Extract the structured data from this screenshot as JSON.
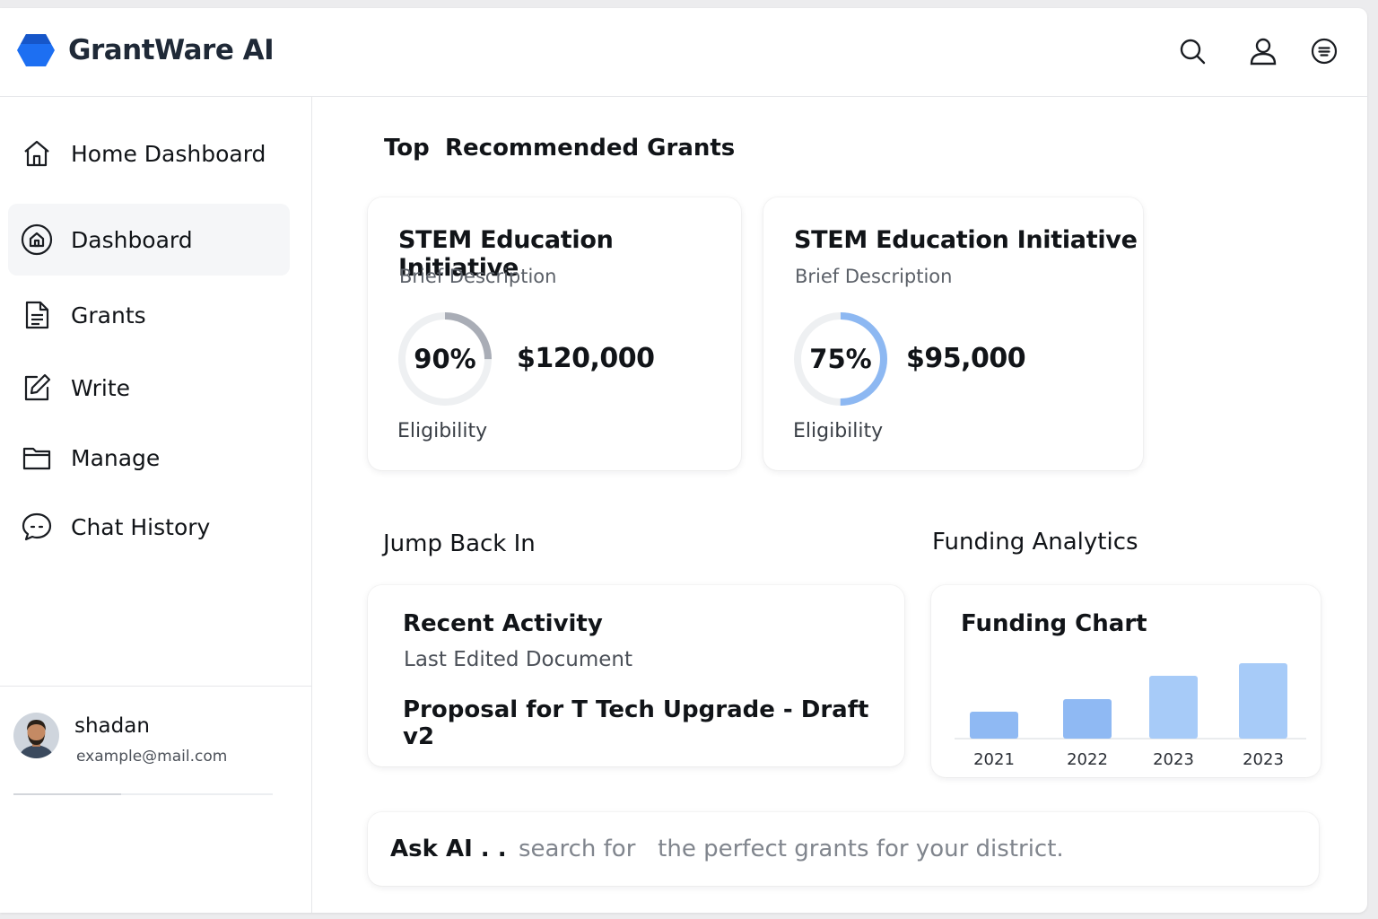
{
  "app": {
    "name": "GrantWare AI",
    "brand_color": "#2563eb"
  },
  "header": {
    "icons": [
      "search-icon",
      "user-icon",
      "menu-icon"
    ]
  },
  "sidebar": {
    "items": [
      {
        "label": "Home Dashboard",
        "icon": "home-icon",
        "active": false
      },
      {
        "label": "Dashboard",
        "icon": "dashboard-icon",
        "active": true
      },
      {
        "label": "Grants",
        "icon": "document-icon",
        "active": false
      },
      {
        "label": "Write",
        "icon": "edit-icon",
        "active": false
      },
      {
        "label": "Manage",
        "icon": "folder-icon",
        "active": false
      },
      {
        "label": "Chat History",
        "icon": "chat-icon",
        "active": false
      }
    ],
    "user": {
      "name": "shadan",
      "email": "example@mail.com"
    }
  },
  "main": {
    "recommended_title_a": "Top",
    "recommended_title_b": "Recommended Grants",
    "grants": [
      {
        "title": "STEM Education Initiative",
        "description": "Brief Description",
        "eligibility_value": "90%",
        "eligibility_fraction": 0.9,
        "amount": "$120,000",
        "eligibility_label": "Eligibility",
        "ring_color": "#a9adb6"
      },
      {
        "title": "STEM Education Initiative",
        "description": "Brief Description",
        "eligibility_value": "75%",
        "eligibility_fraction": 0.75,
        "amount": "$95,000",
        "eligibility_label": "Eligibility",
        "ring_color": "#8db8f2"
      }
    ],
    "jump_back_title": "Jump Back In",
    "recent_activity": {
      "title": "Recent Activity",
      "subtitle": "Last Edited Document",
      "document": "Proposal for T Tech Upgrade - Draft v2"
    },
    "analytics_title": "Funding Analytics",
    "funding_chart_title": "Funding Chart",
    "ask": {
      "label": "Ask AI . .",
      "placeholder": "search for   the perfect grants for your district."
    }
  },
  "chart_data": {
    "type": "bar",
    "title": "Funding Chart",
    "categories": [
      "2021",
      "2022",
      "2023",
      "2023"
    ],
    "values": [
      30,
      44,
      70,
      84
    ],
    "ylim": [
      0,
      100
    ],
    "grid": false,
    "colors": [
      "#8fb9f3",
      "#8fb9f3",
      "#a7cbf8",
      "#a7cbf8"
    ]
  }
}
